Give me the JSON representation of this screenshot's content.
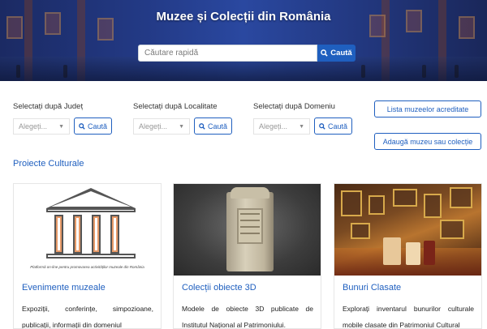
{
  "hero": {
    "title": "Muzee și Colecții din România",
    "search_placeholder": "Căutare rapidă",
    "search_button": "Caută"
  },
  "filters": [
    {
      "label": "Selectați după Județ",
      "placeholder": "Alegeți...",
      "button": "Caută"
    },
    {
      "label": "Selectați după Localitate",
      "placeholder": "Alegeți...",
      "button": "Caută"
    },
    {
      "label": "Selectați după Domeniu",
      "placeholder": "Alegeți...",
      "button": "Caută"
    }
  ],
  "actions": {
    "accredited_list": "Lista muzeelor acreditate",
    "add_museum": "Adaugă muzeu sau colecție"
  },
  "section": {
    "title": "Proiecte Culturale"
  },
  "cards": [
    {
      "title": "Evenimente muzeale",
      "text": "Expoziții, conferințe, simpozioane, publicații, informații din domeniul",
      "image_caption": "Platformă on-line pentru promovarea activităților muzeale din România"
    },
    {
      "title": "Colecții obiecte 3D",
      "text": "Modele de obiecte 3D publicate de Institutul Național al Patrimoniului."
    },
    {
      "title": "Bunuri Clasate",
      "text": "Explorați inventarul bunurilor culturale mobile clasate din Patrimoniul Cultural"
    }
  ],
  "colors": {
    "accent": "#1f5fbf",
    "hero": "#233a86"
  }
}
